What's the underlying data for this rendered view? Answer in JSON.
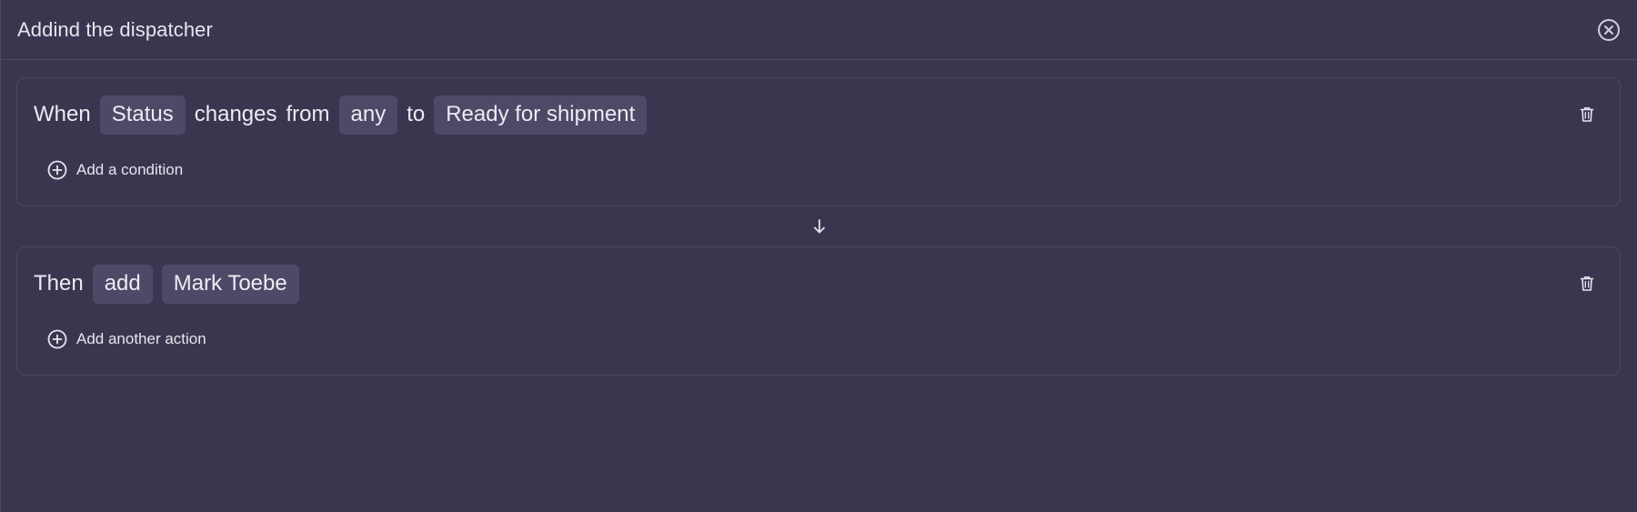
{
  "header": {
    "title": "Addind the dispatcher"
  },
  "when_block": {
    "when_label": "When",
    "field_chip": "Status",
    "changes_word": "changes",
    "from_word": "from",
    "from_chip": "any",
    "to_word": "to",
    "to_chip": "Ready for shipment",
    "add_condition_label": "Add a condition"
  },
  "then_block": {
    "then_label": "Then",
    "action_chip": "add",
    "target_chip": "Mark Toebe",
    "add_action_label": "Add another action"
  },
  "icons": {
    "close": "close-circle-icon",
    "trash": "trash-icon",
    "add": "plus-circle-icon",
    "flow": "arrow-down-icon"
  },
  "colors": {
    "background": "#393750",
    "chip": "#4c4a66",
    "border": "#4b4963",
    "text": "#ecebf4"
  }
}
